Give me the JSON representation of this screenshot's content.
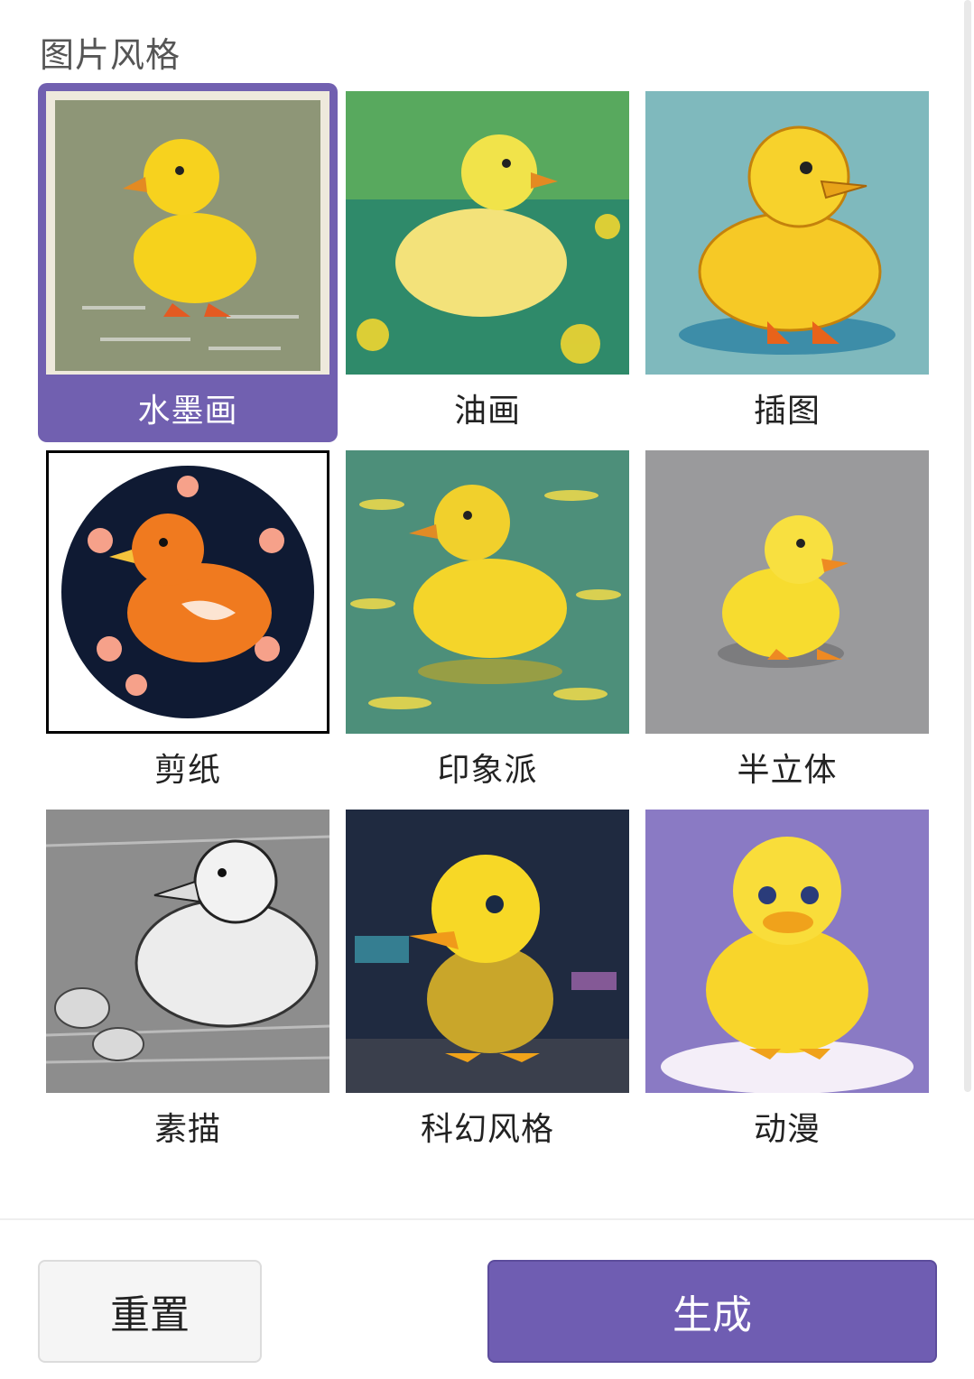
{
  "section_title": "图片风格",
  "styles": [
    {
      "label": "水墨画",
      "selected": true,
      "icon": "duck-ink-painting-thumbnail"
    },
    {
      "label": "油画",
      "selected": false,
      "icon": "duck-oil-painting-thumbnail"
    },
    {
      "label": "插图",
      "selected": false,
      "icon": "duck-illustration-thumbnail"
    },
    {
      "label": "剪纸",
      "selected": false,
      "icon": "duck-paper-cut-thumbnail"
    },
    {
      "label": "印象派",
      "selected": false,
      "icon": "duck-impressionism-thumbnail"
    },
    {
      "label": "半立体",
      "selected": false,
      "icon": "duck-semi-3d-thumbnail"
    },
    {
      "label": "素描",
      "selected": false,
      "icon": "duck-sketch-thumbnail"
    },
    {
      "label": "科幻风格",
      "selected": false,
      "icon": "duck-sci-fi-thumbnail"
    },
    {
      "label": "动漫",
      "selected": false,
      "icon": "duck-anime-thumbnail"
    }
  ],
  "buttons": {
    "reset_label": "重置",
    "generate_label": "生成"
  },
  "colors": {
    "accent": "#6f5db2",
    "duck_yellow": "#f7d21e"
  }
}
